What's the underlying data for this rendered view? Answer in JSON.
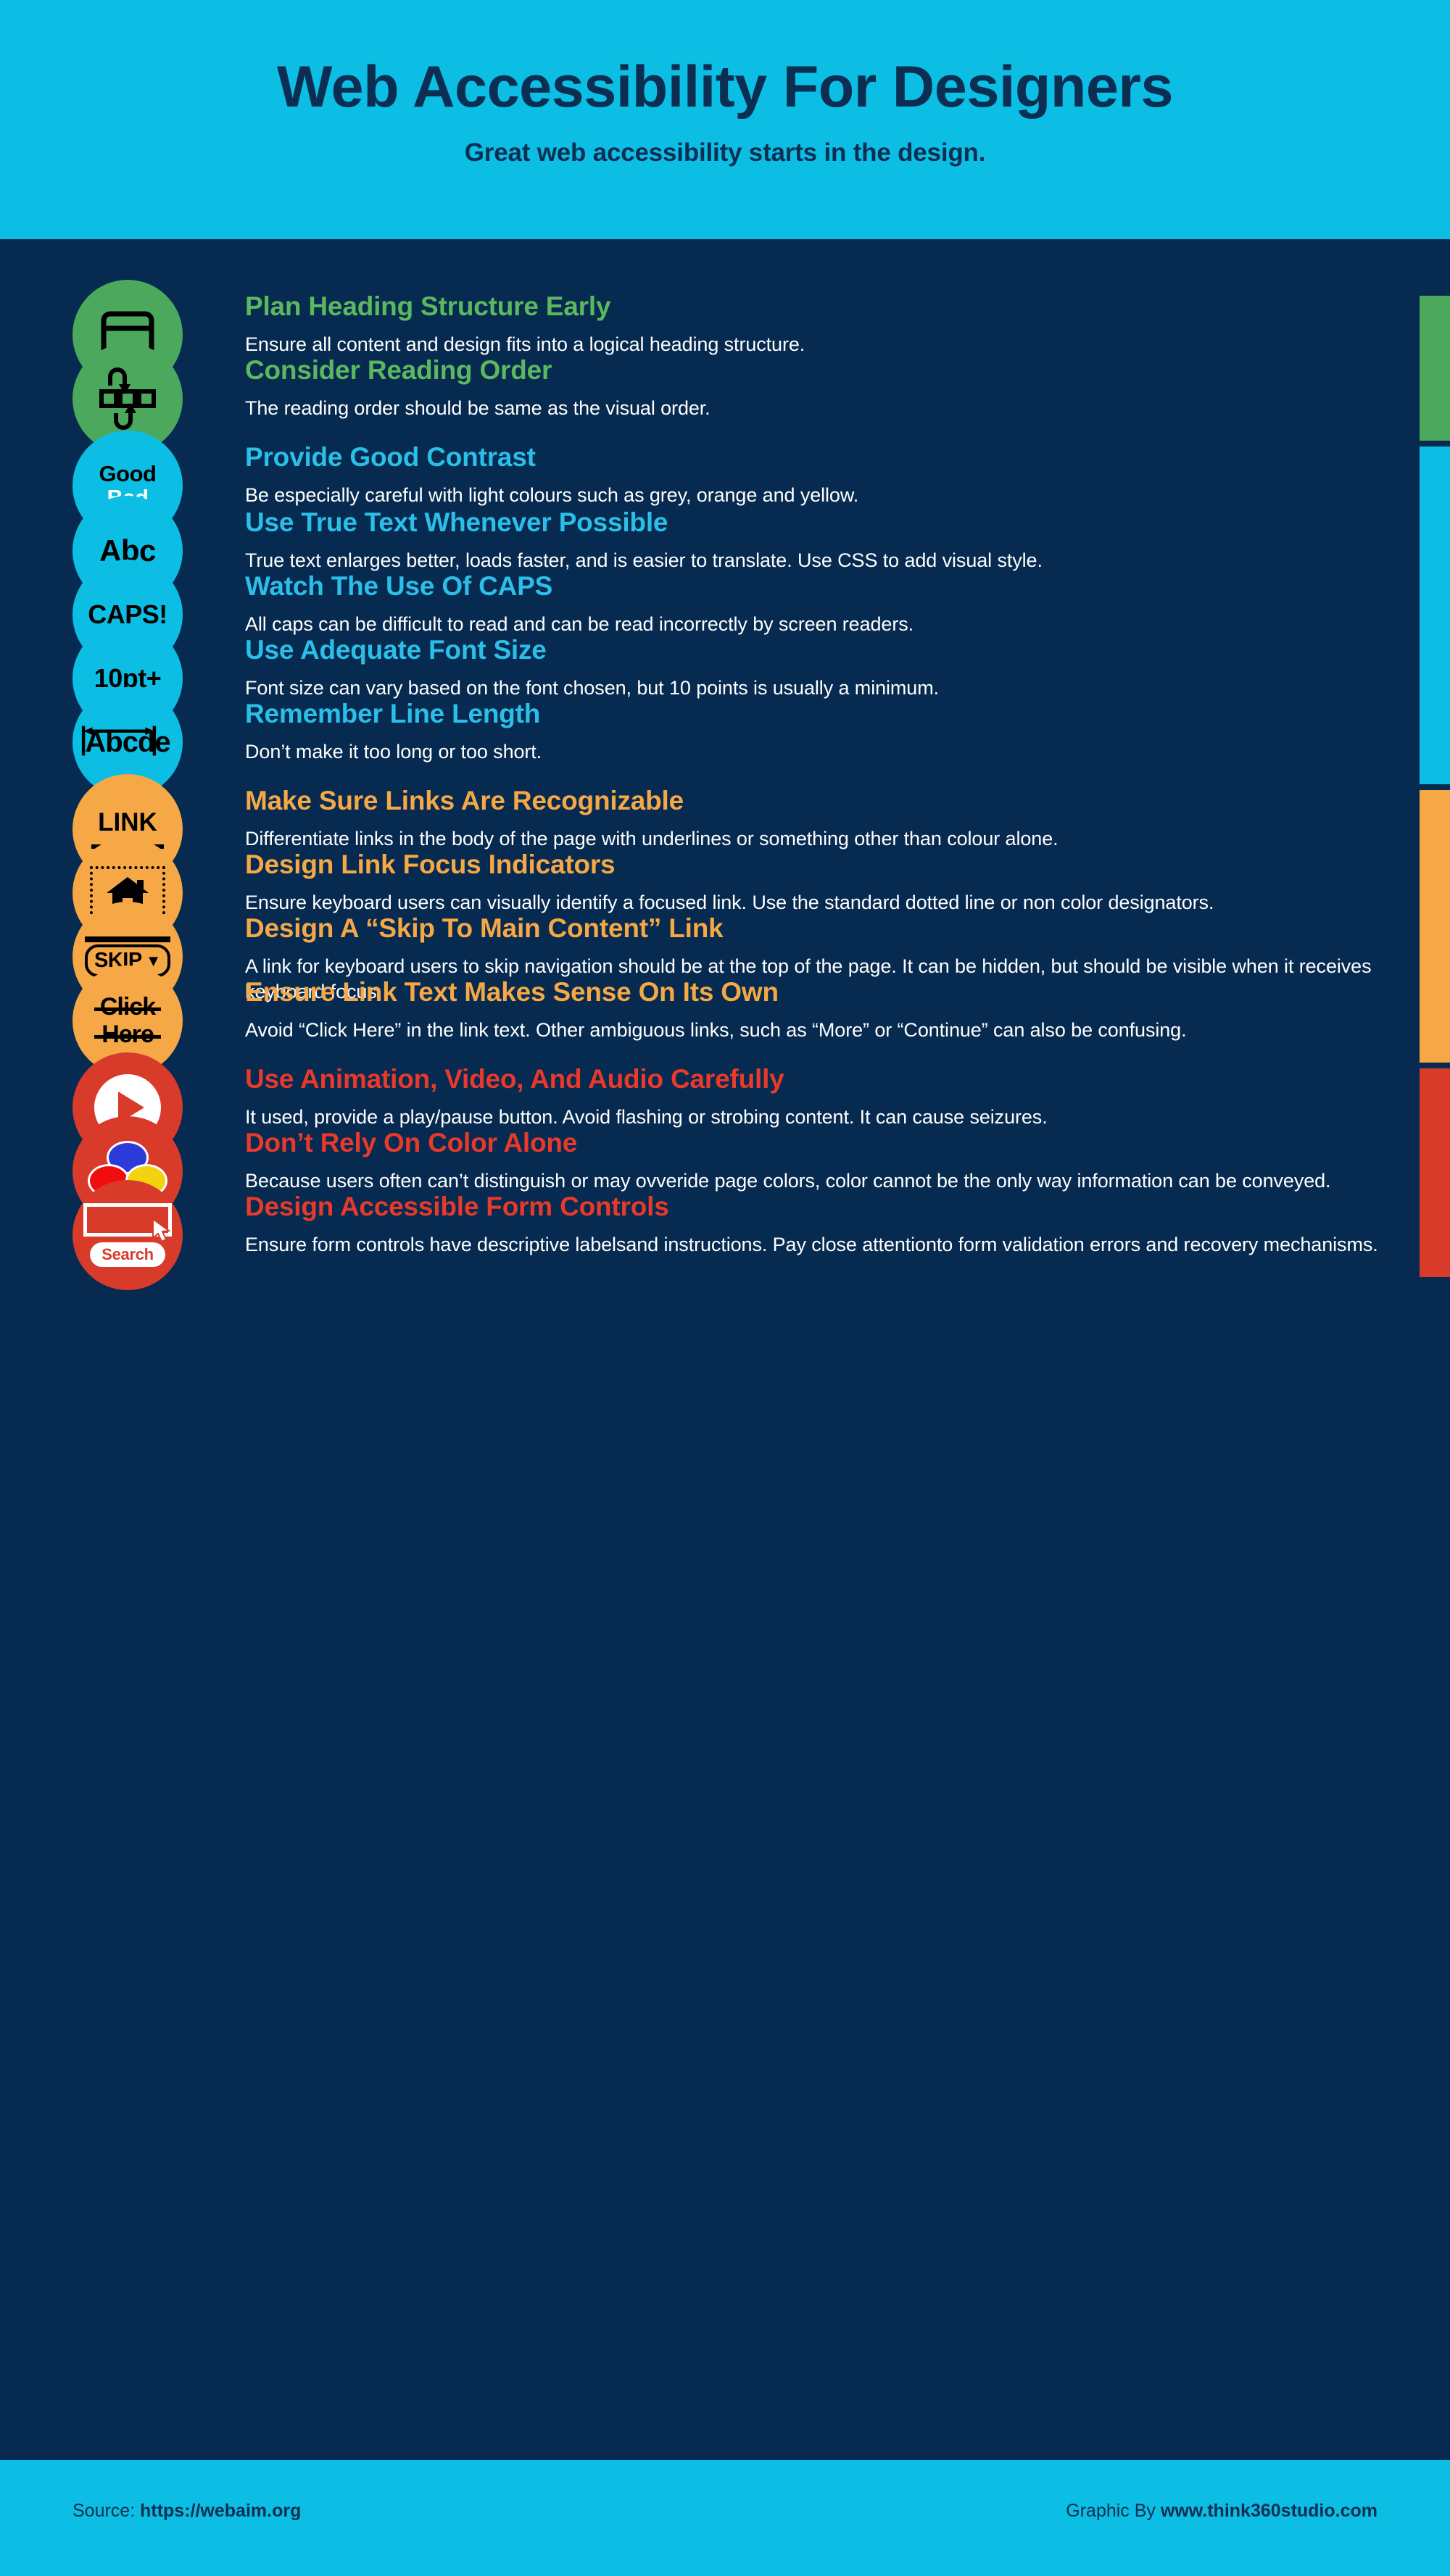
{
  "header": {
    "title": "Web Accessibility For Designers",
    "subtitle": "Great web accessibility starts in the design.",
    "bg_color": "#0cbee4",
    "text_color": "#0b2e52"
  },
  "page": {
    "background_color": "#062a50"
  },
  "groups": [
    {
      "name": "structure",
      "accent_color": "#4ca85c",
      "title_color": "#5cb85f"
    },
    {
      "name": "text",
      "accent_color": "#0cbee4",
      "title_color": "#2bbfe8"
    },
    {
      "name": "links",
      "accent_color": "#f5a845",
      "title_color": "#f5a845"
    },
    {
      "name": "media",
      "accent_color": "#d93b2b",
      "title_color": "#e8392b"
    }
  ],
  "items": [
    {
      "group": "structure",
      "icon": "heading-structure-icon",
      "icon_label": "",
      "title": "Plan Heading Structure Early",
      "desc": "Ensure all content and design fits into a logical heading structure."
    },
    {
      "group": "structure",
      "icon": "reading-order-icon",
      "icon_label": "",
      "title": "Consider Reading Order",
      "desc": "The reading order should be same as the visual order."
    },
    {
      "group": "text",
      "icon": "contrast-icon",
      "icon_label": "Good Bad",
      "icon_label_top": "Good",
      "icon_label_bottom": "Bad",
      "title": "Provide Good Contrast",
      "desc": "Be especially careful with light colours such as grey, orange and yellow."
    },
    {
      "group": "text",
      "icon": "true-text-icon",
      "icon_label": "Abc",
      "title": "Use True Text Whenever Possible",
      "desc": "True text enlarges better, loads faster, and is easier to translate. Use CSS to add visual style."
    },
    {
      "group": "text",
      "icon": "caps-icon",
      "icon_label": "CAPS!",
      "title": "Watch The Use Of CAPS",
      "desc": "All caps can be difficult to read and can be read incorrectly by screen readers."
    },
    {
      "group": "text",
      "icon": "font-size-icon",
      "icon_label": "10pt+",
      "title": "Use Adequate Font Size",
      "desc": "Font size can vary based on the font chosen, but 10 points is usually a minimum."
    },
    {
      "group": "text",
      "icon": "line-length-icon",
      "icon_label": "Abcde",
      "title": "Remember Line Length",
      "desc": "Don’t make it too long or too short."
    },
    {
      "group": "links",
      "icon": "link-underline-icon",
      "icon_label": "LINK",
      "title": "Make Sure Links Are Recognizable",
      "desc": "Differentiate links in the body of the page with underlines or something other than colour alone."
    },
    {
      "group": "links",
      "icon": "focus-indicator-home-icon",
      "icon_label": "",
      "title": "Design Link Focus Indicators",
      "desc": "Ensure keyboard users can visually identify a focused link. Use the standard dotted line or non color designators."
    },
    {
      "group": "links",
      "icon": "skip-link-icon",
      "icon_label": "SKIP",
      "title": "Design A “Skip To Main Content” Link",
      "desc": "A link for keyboard users to skip navigation should be at the top of the page. It can be hidden, but should be visible when it receives keyboard focus."
    },
    {
      "group": "links",
      "icon": "click-here-strikethrough-icon",
      "icon_label": "Click Here",
      "icon_label_top": "Click",
      "icon_label_bottom": "Here",
      "title": "Ensure Link Text Makes Sense On Its Own",
      "desc": "Avoid “Click Here” in the link text. Other ambiguous links, such as “More” or “Continue” can also be confusing."
    },
    {
      "group": "media",
      "icon": "play-button-icon",
      "icon_label": "",
      "title": "Use Animation, Video, And Audio Carefully",
      "desc": "It used, provide a play/pause button. Avoid flashing or strobing content. It can cause seizures."
    },
    {
      "group": "media",
      "icon": "color-circles-icon",
      "icon_label": "",
      "title": "Don’t Rely On Color Alone",
      "desc": "Because users often can’t distinguish or may ovveride page colors, color cannot be the only way information can be conveyed."
    },
    {
      "group": "media",
      "icon": "search-form-icon",
      "icon_label": "Search",
      "title": "Design Accessible Form Controls",
      "desc": "Ensure form controls have descriptive labelsand instructions. Pay close attentionto form validation errors and recovery mechanisms."
    }
  ],
  "footer": {
    "source_prefix": "Source: ",
    "source_url": "https://webaim.org",
    "credit_prefix": "Graphic By ",
    "credit_url": "www.think360studio.com",
    "bg_color": "#0cbee4"
  }
}
